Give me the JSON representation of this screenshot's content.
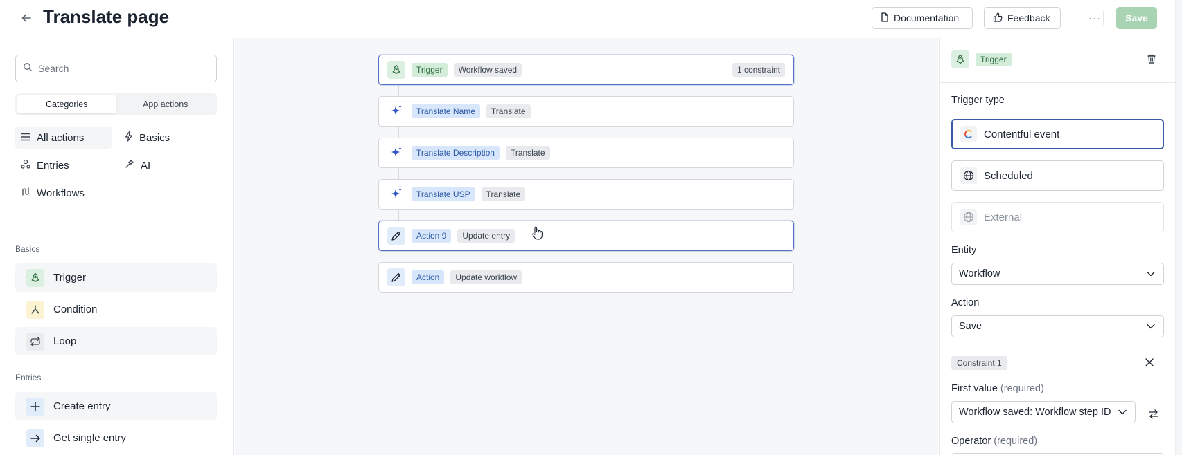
{
  "header": {
    "title": "Translate page",
    "documentation_label": "Documentation",
    "feedback_label": "Feedback",
    "more_label": "···",
    "save_label": "Save"
  },
  "left_panel": {
    "search_placeholder": "Search",
    "segments": [
      "Categories",
      "App actions"
    ],
    "categories": [
      {
        "label": "All actions",
        "icon": "list-icon"
      },
      {
        "label": "Basics",
        "icon": "bolt-icon"
      },
      {
        "label": "Entries",
        "icon": "entries-icon"
      },
      {
        "label": "AI",
        "icon": "ai-sparkle-icon"
      },
      {
        "label": "Workflows",
        "icon": "workflow-icon"
      }
    ],
    "basics_label": "Basics",
    "basics_items": [
      {
        "label": "Trigger",
        "icon": "rocket-icon"
      },
      {
        "label": "Condition",
        "icon": "branch-icon"
      },
      {
        "label": "Loop",
        "icon": "loop-icon"
      }
    ],
    "entries_label": "Entries",
    "entries_items": [
      {
        "label": "Create entry",
        "icon": "plus-icon"
      },
      {
        "label": "Get single entry",
        "icon": "arrow-right-icon"
      }
    ]
  },
  "canvas": {
    "nodes": [
      {
        "name": "Trigger",
        "type": "Workflow saved",
        "extra": "1 constraint",
        "icon": "rocket-icon"
      },
      {
        "name": "Translate Name",
        "type": "Translate",
        "icon": "sparkle-icon"
      },
      {
        "name": "Translate Description",
        "type": "Translate",
        "icon": "sparkle-icon"
      },
      {
        "name": "Translate USP",
        "type": "Translate",
        "icon": "sparkle-icon"
      },
      {
        "name": "Action 9",
        "type": "Update entry",
        "icon": "pencil-icon"
      },
      {
        "name": "Action",
        "type": "Update workflow",
        "icon": "pencil-icon"
      }
    ]
  },
  "right_panel": {
    "header_tag": "Trigger",
    "trigger_type_label": "Trigger type",
    "trigger_options": [
      {
        "label": "Contentful event",
        "icon": "contentful-icon"
      },
      {
        "label": "Scheduled",
        "icon": "globe-icon"
      },
      {
        "label": "External",
        "icon": "globe-icon"
      }
    ],
    "entity_label": "Entity",
    "entity_value": "Workflow",
    "action_label": "Action",
    "action_value": "Save",
    "constraint_tag": "Constraint 1",
    "first_value_label": "First value",
    "first_value_req": "(required)",
    "first_value_value": "Workflow saved: Workflow step ID",
    "operator_label": "Operator",
    "operator_req": "(required)"
  },
  "colors": {
    "accent_blue": "#3d5aa8",
    "save_disabled": "#a8d4b4",
    "tag_green": "#d4edda",
    "tag_blue": "#d8e6fb"
  }
}
